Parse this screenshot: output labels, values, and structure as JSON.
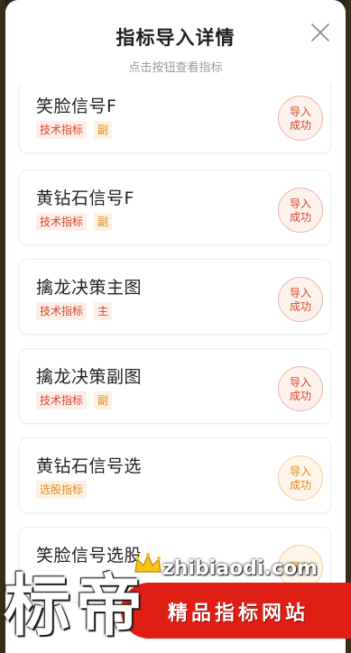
{
  "header": {
    "title": "指标导入详情",
    "subtitle": "点击按钮查看指标",
    "close_icon": "close-icon"
  },
  "items": [
    {
      "name": "笑脸信号F",
      "tags": [
        {
          "text": "技术指标",
          "kind": "tech"
        },
        {
          "text": "副",
          "kind": "sub"
        }
      ],
      "status": "导入成功",
      "status_color": "red"
    },
    {
      "name": "黄钻石信号F",
      "tags": [
        {
          "text": "技术指标",
          "kind": "tech"
        },
        {
          "text": "副",
          "kind": "sub"
        }
      ],
      "status": "导入成功",
      "status_color": "red"
    },
    {
      "name": "擒龙决策主图",
      "tags": [
        {
          "text": "技术指标",
          "kind": "tech"
        },
        {
          "text": "主",
          "kind": "main"
        }
      ],
      "status": "导入成功",
      "status_color": "red"
    },
    {
      "name": "擒龙决策副图",
      "tags": [
        {
          "text": "技术指标",
          "kind": "tech"
        },
        {
          "text": "副",
          "kind": "sub"
        }
      ],
      "status": "导入成功",
      "status_color": "red"
    },
    {
      "name": "黄钻石信号选",
      "tags": [
        {
          "text": "选股指标",
          "kind": "select"
        }
      ],
      "status": "导入成功",
      "status_color": "orange"
    },
    {
      "name": "笑脸信号选股",
      "tags": [],
      "status": "导入",
      "status_color": "orange"
    }
  ],
  "watermark": {
    "big_text": "标帝",
    "url": "zhibiaodi.com",
    "slogan": "精品指标网站"
  },
  "colors": {
    "accent_red": "#d8452b",
    "accent_orange": "#df8a26",
    "watermark_red": "#e01f14"
  }
}
